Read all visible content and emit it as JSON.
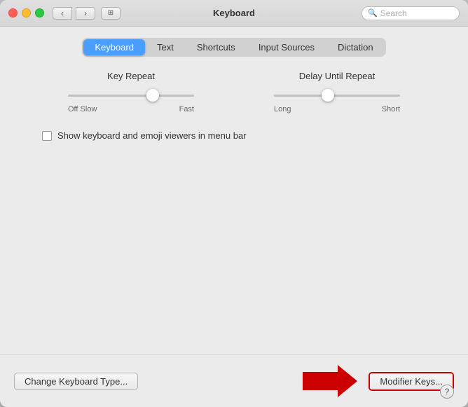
{
  "window": {
    "title": "Keyboard",
    "search_placeholder": "Search"
  },
  "tabs": [
    {
      "id": "keyboard",
      "label": "Keyboard",
      "active": true
    },
    {
      "id": "text",
      "label": "Text",
      "active": false
    },
    {
      "id": "shortcuts",
      "label": "Shortcuts",
      "active": false
    },
    {
      "id": "input-sources",
      "label": "Input Sources",
      "active": false
    },
    {
      "id": "dictation",
      "label": "Dictation",
      "active": false
    }
  ],
  "sliders": {
    "key_repeat": {
      "label": "Key Repeat",
      "left_label": "Off",
      "left_label2": "Slow",
      "right_label": "Fast",
      "thumb_position": "62"
    },
    "delay_until_repeat": {
      "label": "Delay Until Repeat",
      "left_label": "Long",
      "right_label": "Short",
      "thumb_position": "38"
    }
  },
  "checkbox": {
    "label": "Show keyboard and emoji viewers in menu bar",
    "checked": false
  },
  "buttons": {
    "change_keyboard": "Change Keyboard Type...",
    "modifier_keys": "Modifier Keys..."
  },
  "help": "?"
}
